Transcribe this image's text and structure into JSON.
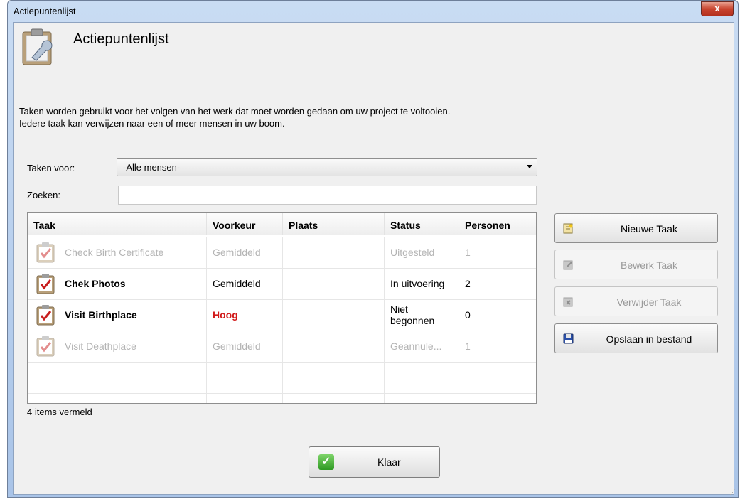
{
  "window": {
    "title": "Actiepuntenlijst",
    "close_label": "x"
  },
  "header": {
    "title": "Actiepuntenlijst",
    "description_line1": "Taken worden gebruikt voor het volgen van het werk dat moet worden gedaan om uw project te voltooien.",
    "description_line2": "Iedere taak kan verwijzen naar een of meer mensen in uw boom."
  },
  "filters": {
    "taken_voor_label": "Taken voor:",
    "taken_voor_value": "-Alle mensen-",
    "zoeken_label": "Zoeken:",
    "zoeken_value": ""
  },
  "table": {
    "columns": [
      "Taak",
      "Voorkeur",
      "Plaats",
      "Status",
      "Personen"
    ],
    "rows": [
      {
        "taak": "Check Birth Certificate",
        "voorkeur": "Gemiddeld",
        "plaats": "",
        "status": "Uitgesteld",
        "personen": "1"
      },
      {
        "taak": "Chek Photos",
        "voorkeur": "Gemiddeld",
        "plaats": "",
        "status": "In uitvoering",
        "personen": "2"
      },
      {
        "taak": "Visit Birthplace",
        "voorkeur": "Hoog",
        "plaats": "",
        "status": "Niet begonnen",
        "personen": "0"
      },
      {
        "taak": "Visit Deathplace",
        "voorkeur": "Gemiddeld",
        "plaats": "",
        "status": "Geannule...",
        "personen": "1"
      }
    ],
    "count_text": "4 items vermeld"
  },
  "buttons": {
    "new_task": "Nieuwe Taak",
    "edit_task": "Bewerk Taak",
    "delete_task": "Verwijder Taak",
    "save_file": "Opslaan in bestand",
    "done": "Klaar"
  },
  "colors": {
    "high_priority": "#d11a1a",
    "disabled_text": "#b4b4b4",
    "title_bar": "#c9dcf3"
  },
  "icons": [
    "clipboard-wrench-icon",
    "clipboard-check-icon",
    "new-task-icon",
    "edit-task-icon",
    "delete-task-icon",
    "floppy-disk-icon",
    "checkmark-icon"
  ]
}
